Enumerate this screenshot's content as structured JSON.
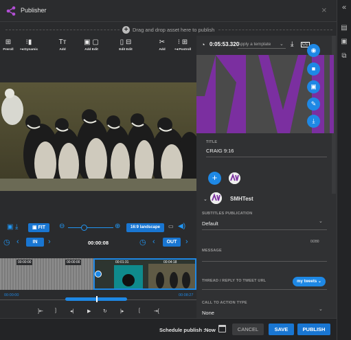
{
  "header": {
    "title": "Publisher"
  },
  "dropzone": {
    "text": "Drag and drop asset here to publish"
  },
  "toolbar": {
    "items": [
      {
        "label": "Preroll",
        "icon": "⊞"
      },
      {
        "label": "+◂ Dynamic",
        "icon": "⁝▮"
      },
      {
        "label": "Add",
        "icon": "Tт"
      },
      {
        "label": "Add  Edit",
        "icon": "▣ ▢"
      },
      {
        "label": "Edit  Edit",
        "icon": "▯ ⊟"
      },
      {
        "label": "Add",
        "icon": "✂"
      },
      {
        "label": "+◂ Postroll",
        "icon": "⁝ ⊞"
      }
    ]
  },
  "video_controls": {
    "fit_label": "FIT",
    "aspect_label": "16:9 landscape",
    "in_label": "IN",
    "out_label": "OUT",
    "current_time": "00:00:08"
  },
  "timeline": {
    "labels": [
      "00:00:00",
      "00:00:00",
      "00:01:31",
      "00:04:18"
    ],
    "start_time": "00:00:00",
    "end_time": "00:08:27"
  },
  "playback": {
    "controls": [
      "]⇤",
      "]",
      "◂|",
      "▶",
      "↻",
      "|▸",
      "[",
      "⇥["
    ]
  },
  "footer": {
    "schedule_label": "Schedule publish :",
    "schedule_value": "Now",
    "cancel_label": "CANCEL",
    "save_label": "SAVE",
    "publish_label": "PUBLISH"
  },
  "panel": {
    "duration": "0:05:53.320",
    "template_placeholder": "Apply a template",
    "title_label": "TITLE",
    "title_value": "CRAIG 9:16",
    "account_name": "SMHTest",
    "subtitles_label": "SUBTITLES PUBLICATION",
    "subtitles_value": "Default",
    "char_count": "0/280",
    "message_label": "MESSAGE",
    "thread_label": "THREAD / REPLY TO TWEET URL",
    "thread_button": "my tweets",
    "cta_label": "CALL TO ACTION TYPE",
    "cta_value": "None"
  },
  "colors": {
    "accent": "#1e88e5",
    "brand_purple": "#7b2fa0",
    "background": "#2a2b2d"
  }
}
